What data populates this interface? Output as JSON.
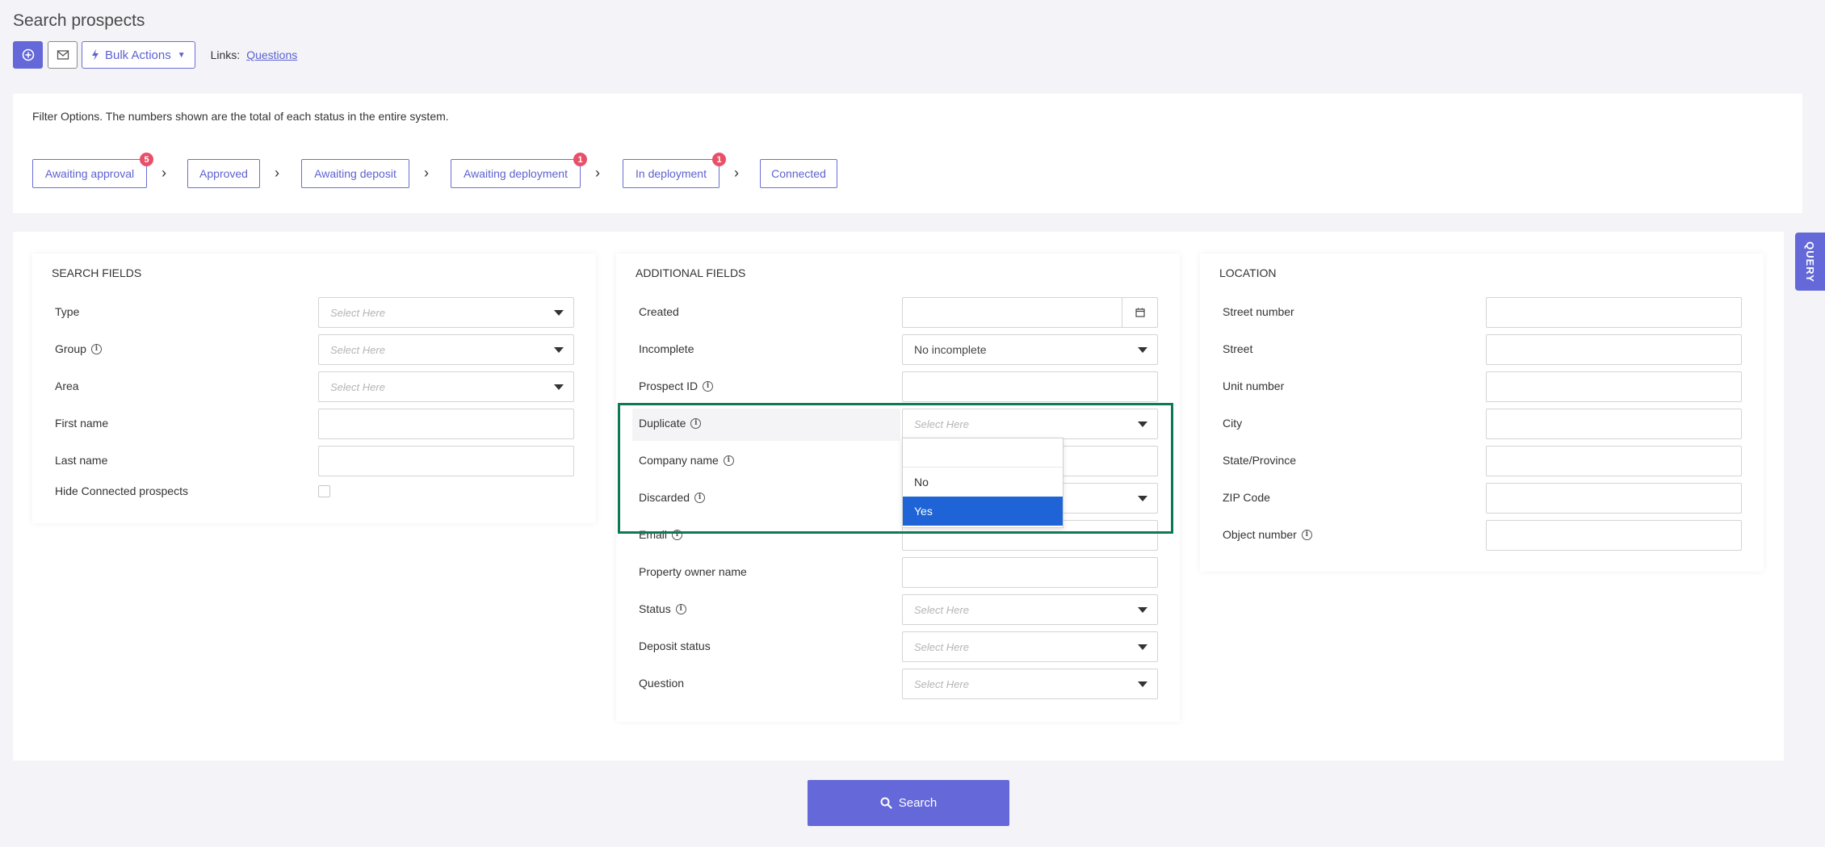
{
  "page": {
    "title": "Search prospects"
  },
  "toolbar": {
    "add_icon": "plus-circle-icon",
    "mail_icon": "envelope-icon",
    "bulk_icon": "lightning-icon",
    "bulk_label": "Bulk Actions",
    "links_label": "Links:",
    "links": [
      {
        "label": "Questions"
      }
    ]
  },
  "filter": {
    "description": "Filter Options. The numbers shown are the total of each status in the entire system.",
    "statuses": [
      {
        "label": "Awaiting approval",
        "count": "5"
      },
      {
        "label": "Approved",
        "count": ""
      },
      {
        "label": "Awaiting deposit",
        "count": ""
      },
      {
        "label": "Awaiting deployment",
        "count": "1"
      },
      {
        "label": "In deployment",
        "count": "1"
      },
      {
        "label": "Connected",
        "count": ""
      }
    ]
  },
  "search_fields": {
    "title": "SEARCH FIELDS",
    "type": {
      "label": "Type",
      "placeholder": "Select Here"
    },
    "group": {
      "label": "Group",
      "placeholder": "Select Here"
    },
    "area": {
      "label": "Area",
      "placeholder": "Select Here"
    },
    "first_name": {
      "label": "First name",
      "value": ""
    },
    "last_name": {
      "label": "Last name",
      "value": ""
    },
    "hide_connected": {
      "label": "Hide Connected prospects",
      "checked": false
    }
  },
  "additional_fields": {
    "title": "ADDITIONAL FIELDS",
    "created": {
      "label": "Created",
      "value": ""
    },
    "incomplete": {
      "label": "Incomplete",
      "value": "No incomplete"
    },
    "prospect_id": {
      "label": "Prospect ID",
      "value": ""
    },
    "duplicate": {
      "label": "Duplicate",
      "placeholder": "Select Here",
      "options": [
        "No",
        "Yes"
      ],
      "highlighted": "Yes"
    },
    "company_name": {
      "label": "Company name",
      "value": ""
    },
    "discarded": {
      "label": "Discarded"
    },
    "email": {
      "label": "Email",
      "value": ""
    },
    "property_owner": {
      "label": "Property owner name",
      "value": ""
    },
    "status": {
      "label": "Status",
      "placeholder": "Select Here"
    },
    "deposit_status": {
      "label": "Deposit status",
      "placeholder": "Select Here"
    },
    "question": {
      "label": "Question",
      "placeholder": "Select Here"
    }
  },
  "location": {
    "title": "LOCATION",
    "street_number": {
      "label": "Street number"
    },
    "street": {
      "label": "Street"
    },
    "unit_number": {
      "label": "Unit number"
    },
    "city": {
      "label": "City"
    },
    "state": {
      "label": "State/Province"
    },
    "zip": {
      "label": "ZIP Code"
    },
    "object_number": {
      "label": "Object number"
    }
  },
  "query_tab": {
    "label": "QUERY"
  },
  "search_button": {
    "label": "Search"
  },
  "colors": {
    "accent": "#6468d8",
    "badge": "#e8506a",
    "highlight": "#0d7a54",
    "selected": "#1e64d6"
  }
}
